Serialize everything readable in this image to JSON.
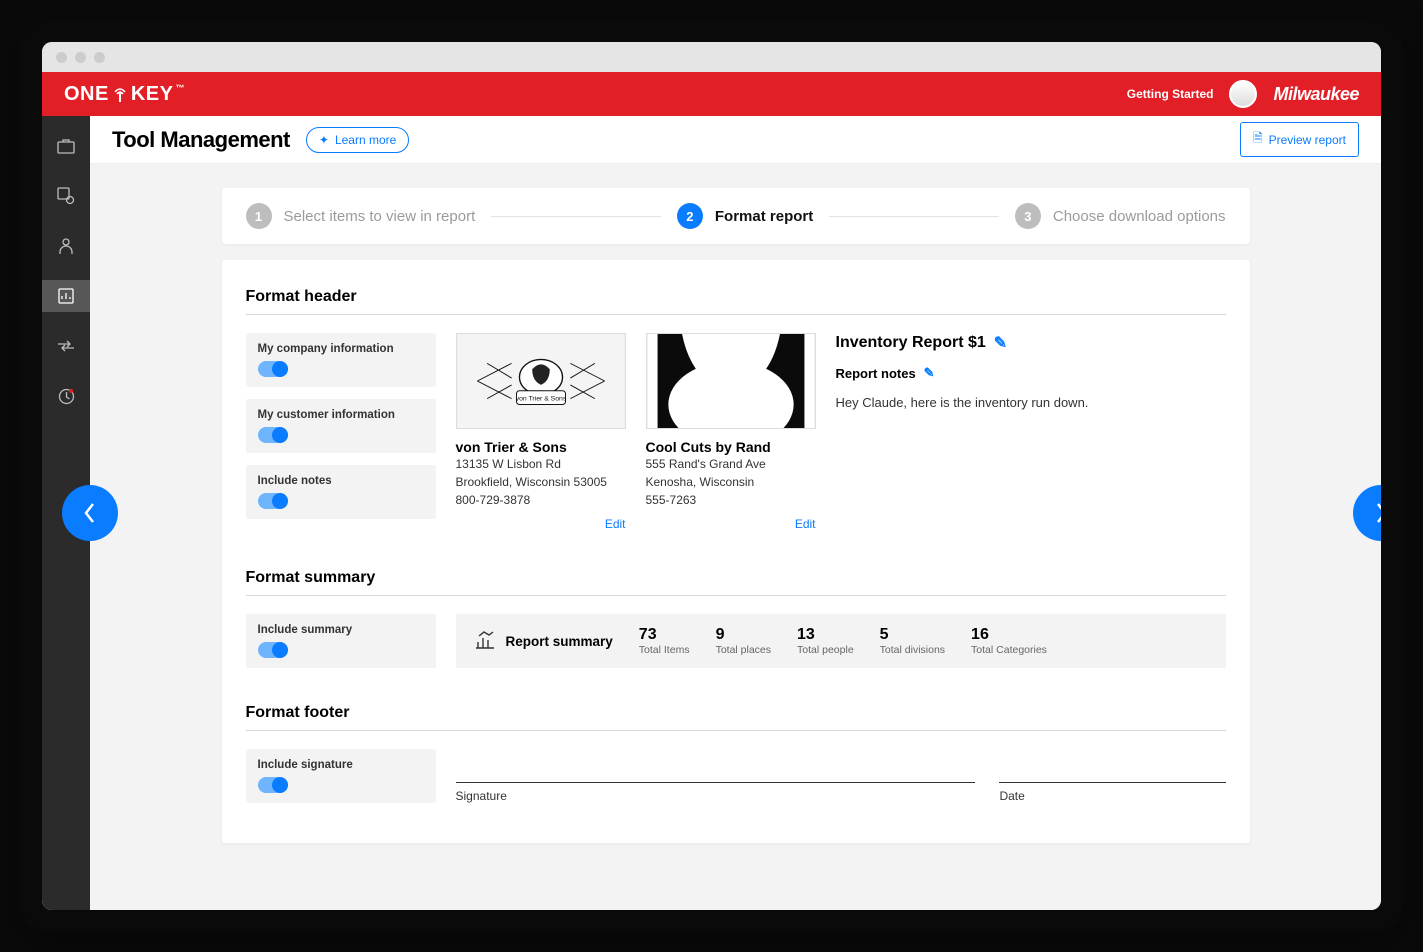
{
  "header": {
    "brand_left": "ONE-KEY",
    "getting_started": "Getting Started",
    "brand_right": "Milwaukee"
  },
  "page": {
    "title": "Tool Management",
    "learn_more": "Learn more",
    "preview": "Preview report"
  },
  "stepper": {
    "steps": [
      {
        "num": "1",
        "label": "Select items to view in report"
      },
      {
        "num": "2",
        "label": "Format report"
      },
      {
        "num": "3",
        "label": "Choose download options"
      }
    ]
  },
  "sections": {
    "format_header": "Format header",
    "format_summary": "Format summary",
    "format_footer": "Format footer"
  },
  "toggles": {
    "company": "My company information",
    "customer": "My customer information",
    "notes": "Include notes",
    "summary": "Include summary",
    "signature": "Include signature"
  },
  "company": {
    "name": "von Trier & Sons",
    "addr1": "13135 W Lisbon Rd",
    "addr2": "Brookfield, Wisconsin 53005",
    "phone": "800-729-3878",
    "edit": "Edit"
  },
  "customer": {
    "name": "Cool Cuts by Rand",
    "addr1": "555 Rand's Grand Ave",
    "addr2": "Kenosha, Wisconsin",
    "phone": "555-7263",
    "edit": "Edit"
  },
  "report": {
    "title": "Inventory Report $1",
    "notes_label": "Report notes",
    "notes_text": "Hey Claude, here is the inventory run down."
  },
  "summary": {
    "label": "Report summary",
    "stats": [
      {
        "v": "73",
        "l": "Total Items"
      },
      {
        "v": "9",
        "l": "Total places"
      },
      {
        "v": "13",
        "l": "Total people"
      },
      {
        "v": "5",
        "l": "Total divisions"
      },
      {
        "v": "16",
        "l": "Total Categories"
      }
    ]
  },
  "footer": {
    "signature": "Signature",
    "date": "Date"
  }
}
